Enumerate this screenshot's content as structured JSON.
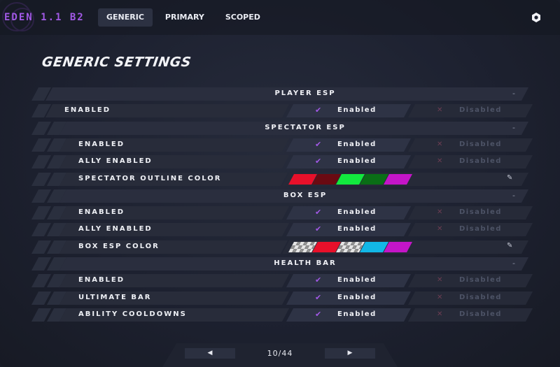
{
  "app": {
    "brand": "EDEN 1.1 B2"
  },
  "tabs": [
    {
      "label": "GENERIC",
      "active": true
    },
    {
      "label": "PRIMARY",
      "active": false
    },
    {
      "label": "SCOPED",
      "active": false
    }
  ],
  "page_title": "GENERIC SETTINGS",
  "options": {
    "enabled_label": "Enabled",
    "disabled_label": "Disabled"
  },
  "icons": {
    "check": "check-icon",
    "cross": "x-icon",
    "gear": "gear-icon",
    "pencil": "pencil-icon",
    "prev": "left-arrow-icon",
    "next": "right-arrow-icon",
    "collapse": "minus-icon"
  },
  "colors": {
    "accent": "#a259e6"
  },
  "sections": [
    {
      "header": "PLAYER ESP",
      "collapse": "-",
      "rows": [
        {
          "label": "ENABLED",
          "type": "toggle",
          "value": "Enabled"
        }
      ]
    },
    {
      "header": "SPECTATOR ESP",
      "collapse": "-",
      "rows": [
        {
          "label": "ENABLED",
          "type": "toggle",
          "value": "Enabled"
        },
        {
          "label": "ALLY ENABLED",
          "type": "toggle",
          "value": "Enabled"
        },
        {
          "label": "SPECTATOR OUTLINE COLOR",
          "type": "colors",
          "colors": [
            "#e8102a",
            "#6a0a12",
            "#12e93e",
            "#0a6e16",
            "#c415c8"
          ]
        }
      ]
    },
    {
      "header": "BOX ESP",
      "collapse": "-",
      "rows": [
        {
          "label": "ENABLED",
          "type": "toggle",
          "value": "Enabled"
        },
        {
          "label": "ALLY ENABLED",
          "type": "toggle",
          "value": "Enabled"
        },
        {
          "label": "BOX ESP COLOR",
          "type": "colors",
          "colors": [
            "checker",
            "#e8102a",
            "checker",
            "#12b7e6",
            "#c415c8"
          ]
        }
      ]
    },
    {
      "header": "HEALTH BAR",
      "collapse": "-",
      "rows": [
        {
          "label": "ENABLED",
          "type": "toggle",
          "value": "Enabled"
        },
        {
          "label": "ULTIMATE BAR",
          "type": "toggle",
          "value": "Enabled"
        },
        {
          "label": "ABILITY COOLDOWNS",
          "type": "toggle",
          "value": "Enabled"
        }
      ]
    }
  ],
  "pager": {
    "page_text": "10/44",
    "prev_glyph": "◀",
    "next_glyph": "▶"
  },
  "glyphs": {
    "check": "✔",
    "cross": "✕",
    "pencil": "✎",
    "collapse": "-"
  }
}
